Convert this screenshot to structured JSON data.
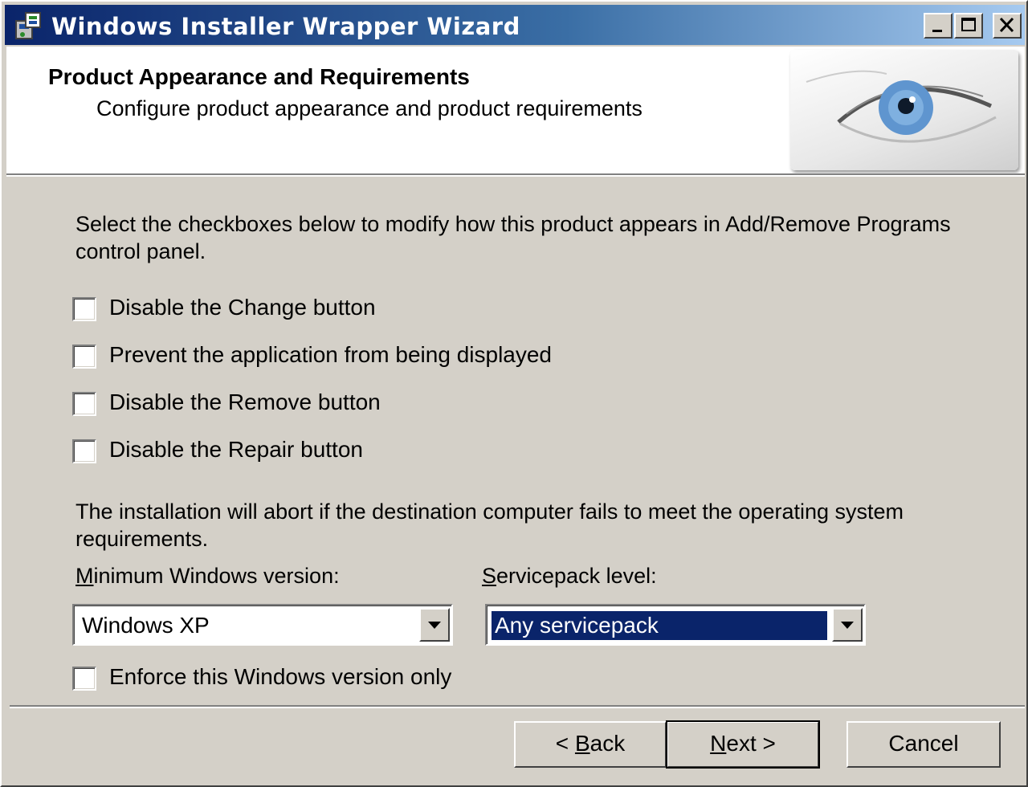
{
  "window": {
    "title": "Windows Installer Wrapper Wizard",
    "title_bar_color": "#0a246a",
    "controls": [
      "minimize-icon",
      "maximize-icon",
      "close-icon"
    ]
  },
  "header": {
    "title": "Product Appearance and Requirements",
    "subtitle": "Configure product appearance and product requirements",
    "image": "eye-graphic"
  },
  "appearance": {
    "intro": "Select the checkboxes below to modify how this product appears in Add/Remove Programs control panel.",
    "checkboxes": [
      {
        "label": "Disable the Change button",
        "checked": false
      },
      {
        "label": "Prevent the application from being displayed",
        "checked": false
      },
      {
        "label": "Disable the Remove button",
        "checked": false
      },
      {
        "label": "Disable the Repair button",
        "checked": false
      }
    ]
  },
  "requirements": {
    "text": "The installation will abort if the destination computer fails to meet the operating system requirements.",
    "min_version": {
      "label_mnemonic": "M",
      "label_rest": "inimum Windows version:",
      "value": "Windows XP"
    },
    "servicepack": {
      "label_mnemonic": "S",
      "label_rest": "ervicepack level:",
      "value": "Any servicepack"
    },
    "enforce": {
      "label": "Enforce this Windows version only",
      "checked": false
    }
  },
  "buttons": {
    "back_prefix": "< ",
    "back_mnemonic": "B",
    "back_rest": "ack",
    "next_mnemonic": "N",
    "next_rest": "ext >",
    "cancel": "Cancel"
  },
  "colors": {
    "face": "#d4d0c8",
    "selection": "#0a246a"
  }
}
